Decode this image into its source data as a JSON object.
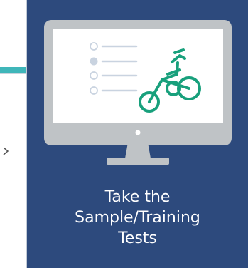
{
  "tile": {
    "label_lines": [
      "Take the",
      "Sample/Training",
      "Tests"
    ]
  },
  "colors": {
    "tile_background": "#2d4a7d",
    "accent_teal": "#3fb6b9",
    "bicycle_green": "#18a07c",
    "monitor_frame": "#bfc3c6",
    "screen": "#ffffff"
  },
  "icons": {
    "monitor": "monitor-icon",
    "checklist": "checklist-icon",
    "tricycle": "tricycle-icon",
    "chevron": "chevron-right-icon"
  }
}
